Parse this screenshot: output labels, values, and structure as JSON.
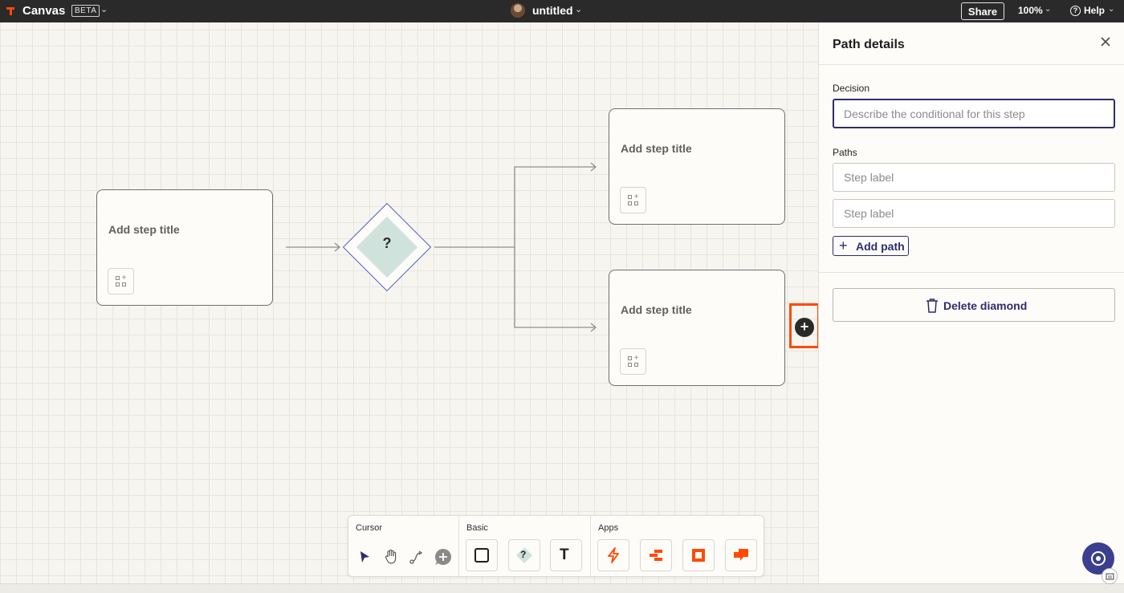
{
  "topbar": {
    "app_name": "Canvas",
    "beta_badge": "BETA",
    "doc_title": "untitled",
    "share_label": "Share",
    "zoom_level": "100%",
    "help_label": "Help"
  },
  "canvas": {
    "steps": [
      {
        "title": "Add step title"
      },
      {
        "title": "Add step title"
      },
      {
        "title": "Add step title"
      }
    ],
    "diamond_symbol": "?"
  },
  "toolbar": {
    "cursor_label": "Cursor",
    "basic_label": "Basic",
    "apps_label": "Apps",
    "cursor_tools": [
      "select-arrow-icon",
      "hand-icon",
      "connector-icon",
      "comment-add-icon"
    ],
    "basic_tools": [
      "rectangle-icon",
      "diamond-icon",
      "text-icon"
    ],
    "basic_text_tool_glyph": "T",
    "basic_diamond_glyph": "?",
    "app_tools": [
      "zap-icon",
      "tables-icon",
      "interfaces-icon",
      "chatbot-icon"
    ],
    "accent_color": "#ff4a00"
  },
  "panel": {
    "title": "Path details",
    "decision_label": "Decision",
    "decision_placeholder": "Describe the conditional for this step",
    "decision_value": "",
    "paths_label": "Paths",
    "paths": [
      {
        "placeholder": "Step label",
        "value": ""
      },
      {
        "placeholder": "Step label",
        "value": ""
      }
    ],
    "add_path_label": "Add path",
    "delete_label": "Delete diamond"
  },
  "colors": {
    "brand_orange": "#ff4a00",
    "primary_navy": "#2d2c6e",
    "diamond_border": "#4a5bc4",
    "diamond_fill": "#cfe3dc"
  }
}
